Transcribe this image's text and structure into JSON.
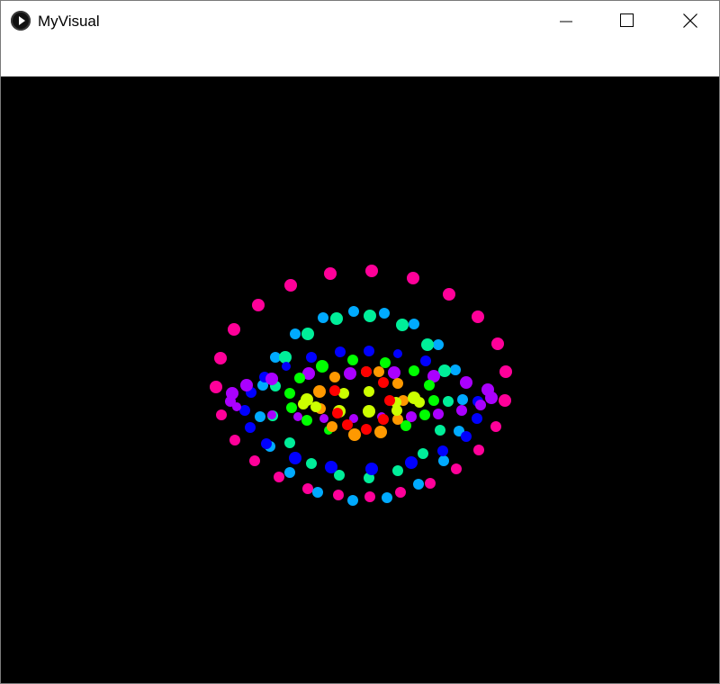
{
  "window": {
    "title": "MyVisual",
    "icon": "play-circle-icon"
  },
  "controls": {
    "minimize_icon": "minimize-icon",
    "maximize_icon": "maximize-icon",
    "close_icon": "close-icon"
  },
  "canvas": {
    "background": "#000000",
    "colors": {
      "red": "#ff0000",
      "orange": "#ff9900",
      "yellow": "#ccff00",
      "green": "#00ff00",
      "teal": "#00ee99",
      "cyan": "#00aaff",
      "blue": "#0000ff",
      "violet": "#aa00ff",
      "magenta": "#ff0099"
    }
  }
}
